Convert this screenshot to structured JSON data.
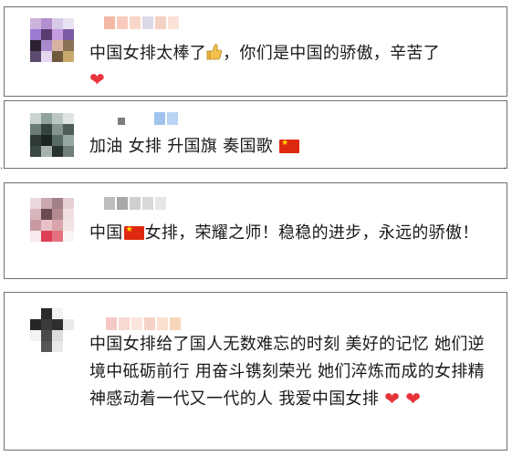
{
  "comments": [
    {
      "text_a": "中国女排太棒了",
      "thumb_icon": "thumbs-up-icon",
      "text_b": "，你们是中国的骄傲，辛苦了",
      "end_icon": "heart-icon"
    },
    {
      "text_a": "加油 女排 升国旗 奏国歌",
      "end_icon": "china-flag-icon"
    },
    {
      "text_a": "中国",
      "flag_icon": "china-flag-icon",
      "text_b": "女排，荣耀之师！稳稳的进步，永远的骄傲！"
    },
    {
      "text_a": "中国女排给了国人无数难忘的时刻 美好的记忆 她们逆境中砥砺前行 用奋斗镌刻荣光 她们淬炼而成的女排精神感动着一代又一代的人 我爱中国女排",
      "end_icon": "heart-icon"
    }
  ],
  "colors": {
    "heart": "#e8333b",
    "flag": "#de2910",
    "border": "#707070"
  }
}
